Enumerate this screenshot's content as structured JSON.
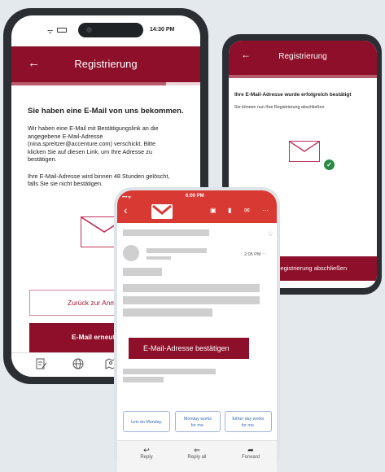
{
  "phone_left": {
    "status_time": "14:30 PM",
    "header_title": "Registrierung",
    "heading": "Sie haben eine E-Mail von uns bekommen.",
    "paragraph1_lines": [
      "Wir haben eine E-Mail mit Bestätigungslink an die",
      "angegebene E-Mail-Adresse",
      "(nina.spreitzer@accenture.com) verschickt. Bitte",
      "klicken Sie auf diesen Link, um Ihre Adresse zu",
      "bestätigen."
    ],
    "paragraph2_lines": [
      "Ihre E-Mail-Adresse wird binnen 48 Stunden gelöscht,",
      "falls Sie sie nicht bestätigen."
    ],
    "btn_back": "Zurück zur Anme",
    "btn_resend": "E-Mail erneut se",
    "progress": 0.82
  },
  "phone_right": {
    "header_title": "Registrierung",
    "heading": "Ihre E-Mail-Adresse wurde erfolgreich bestätigt",
    "text": "Sie können nun Ihre Registrierung abschließen.",
    "btn_finish": "Registrierung abschließen",
    "progress": 1.0
  },
  "phone_email": {
    "status_time": "6:00 PM",
    "timestamp": "2:05 PM",
    "confirm_button": "E-Mail-Adresse bestätigen",
    "smart_replies": [
      {
        "line1": "Lets do Monday.",
        "line2": ""
      },
      {
        "line1": "Monday works",
        "line2": "for me."
      },
      {
        "line1": "Either day works",
        "line2": "for me."
      }
    ],
    "actions": [
      "Reply",
      "Reply all",
      "Forward"
    ]
  },
  "colors": {
    "brand": "#8d0f2a",
    "gmail_red": "#d93933",
    "success": "#2a8a45"
  }
}
